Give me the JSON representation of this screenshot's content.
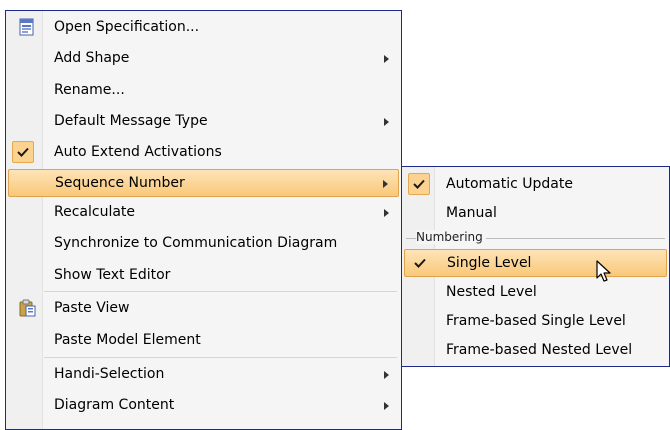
{
  "main_menu": {
    "items": [
      {
        "label": "Open Specification...",
        "icon": "specification-icon",
        "submenu": false
      },
      {
        "label": "Add Shape",
        "submenu": true
      },
      {
        "label": "Rename...",
        "submenu": false
      },
      {
        "label": "Default Message Type",
        "submenu": true
      },
      {
        "label": "Auto Extend Activations",
        "checked": true,
        "submenu": false
      },
      {
        "label": "Sequence Number",
        "submenu": true,
        "highlighted": true
      },
      {
        "label": "Recalculate",
        "submenu": true
      },
      {
        "label": "Synchronize to Communication Diagram",
        "submenu": false
      },
      {
        "label": "Show Text Editor",
        "submenu": false
      },
      {
        "label": "Paste View",
        "icon": "clipboard-icon",
        "submenu": false
      },
      {
        "label": "Paste Model Element",
        "submenu": false
      },
      {
        "label": "Handi-Selection",
        "submenu": true
      },
      {
        "label": "Diagram Content",
        "submenu": true
      }
    ]
  },
  "sequence_submenu": {
    "items": [
      {
        "label": "Automatic Update",
        "checked": true
      },
      {
        "label": "Manual",
        "checked": false
      }
    ],
    "numbering_header": "Numbering",
    "numbering_items": [
      {
        "label": "Single Level",
        "checked": true,
        "highlighted": true
      },
      {
        "label": "Nested Level",
        "checked": false
      },
      {
        "label": "Frame-based Single Level",
        "checked": false
      },
      {
        "label": "Frame-based Nested Level",
        "checked": false
      }
    ]
  },
  "colors": {
    "menu_border": "#1e2a8a",
    "menu_background": "#f5f5f5",
    "highlight_top": "#fde4b8",
    "highlight_bottom": "#f9c879",
    "highlight_border": "#e1a34d",
    "check_box_fill": "#fbd28f"
  }
}
